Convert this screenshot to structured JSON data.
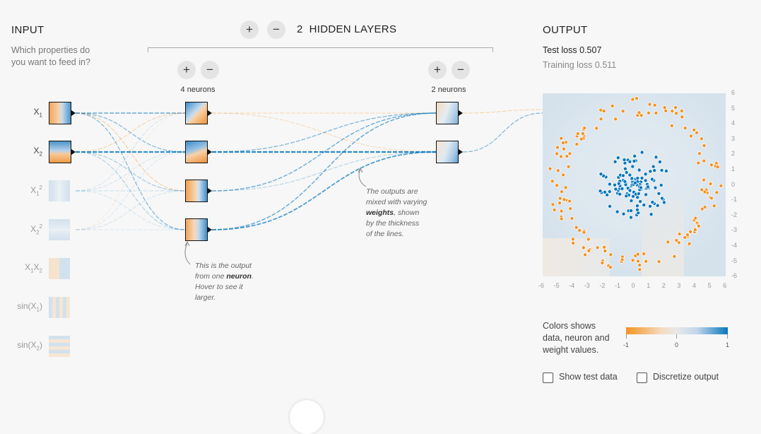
{
  "input": {
    "title": "INPUT",
    "subtitle": [
      "Which properties do",
      "you want to feed in?"
    ],
    "features": [
      {
        "main": "X",
        "sub": "1",
        "sup": ""
      },
      {
        "main": "X",
        "sub": "2",
        "sup": ""
      },
      {
        "main": "X",
        "sub": "1",
        "sup": "2"
      },
      {
        "main": "X",
        "sub": "2",
        "sup": "2"
      },
      {
        "main": "X",
        "sub": "1",
        "sup": "",
        "main2": "X",
        "sub2": "2"
      },
      {
        "main": "sin(X",
        "sub": "1",
        "tail": ")"
      },
      {
        "main": "sin(X",
        "sub": "2",
        "tail": ")"
      }
    ]
  },
  "hidden": {
    "count": "2",
    "title": "HIDDEN LAYERS",
    "add_symbol": "+",
    "remove_symbol": "−",
    "layers": [
      {
        "label": "4 neurons"
      },
      {
        "label": "2 neurons"
      }
    ]
  },
  "notes": {
    "neuron": {
      "l1": "This is the output",
      "l2a": "from one ",
      "l2b": "neuron",
      "l2c": ".",
      "l3": "Hover to see it",
      "l4": "larger."
    },
    "weights": {
      "l1": "The outputs are",
      "l2": "mixed with varying",
      "l3a": "weights",
      "l3b": ", shown",
      "l4": "by the thickness",
      "l5": "of the lines."
    }
  },
  "output": {
    "title": "OUTPUT",
    "test_loss_label": "Test loss",
    "test_loss": "0.507",
    "train_loss_label": "Training loss",
    "train_loss": "0.511",
    "x_ticks": [
      "-6",
      "-5",
      "-4",
      "-3",
      "-2",
      "-1",
      "0",
      "1",
      "2",
      "3",
      "4",
      "5",
      "6"
    ],
    "y_ticks": [
      "6",
      "5",
      "4",
      "3",
      "2",
      "1",
      "0",
      "-1",
      "-2",
      "-3",
      "-4",
      "-5",
      "-6"
    ]
  },
  "legend": {
    "text": [
      "Colors shows",
      "data, neuron and",
      "weight values."
    ],
    "min": "-1",
    "mid": "0",
    "max": "1",
    "orange": "#f59322",
    "blue": "#0877bd"
  },
  "options": {
    "show_test": "Show test data",
    "discretize": "Discretize output"
  }
}
